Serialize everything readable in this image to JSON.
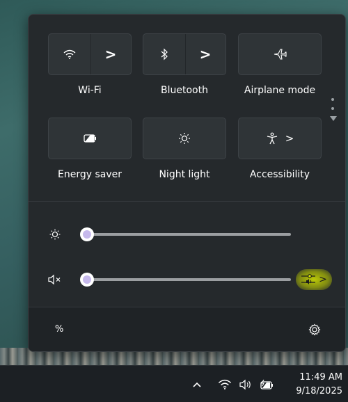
{
  "quick_settings": {
    "tiles": [
      {
        "label": "Wi-Fi",
        "icon": "wifi-icon",
        "has_chevron": true
      },
      {
        "label": "Bluetooth",
        "icon": "bluetooth-icon",
        "has_chevron": true
      },
      {
        "label": "Airplane mode",
        "icon": "airplane-icon",
        "has_chevron": false
      },
      {
        "label": "Energy saver",
        "icon": "energy-saver-icon",
        "has_chevron": false
      },
      {
        "label": "Night light",
        "icon": "night-light-icon",
        "has_chevron": false
      },
      {
        "label": "Accessibility",
        "icon": "accessibility-icon",
        "has_chevron": true
      }
    ],
    "chevron_glyph": ">",
    "pages": {
      "total": 2,
      "current": 1
    },
    "brightness": {
      "icon": "brightness-icon",
      "level": 0
    },
    "volume": {
      "icon": "volume-muted-icon",
      "level": 0,
      "mixer_icon": "sound-mixer-icon",
      "mixer_highlight": "#d6e600"
    },
    "footer": {
      "battery_text": "%",
      "settings_icon": "gear-icon"
    }
  },
  "taskbar": {
    "overflow_glyph": "^",
    "tray_icons": [
      "wifi-icon",
      "speaker-icon",
      "battery-charging-icon"
    ],
    "time": "11:49 AM",
    "date": "9/18/2025"
  },
  "colors": {
    "accent": "#c6b9ec",
    "panel_bg": "#25292c",
    "tile_bg": "#2f3437"
  }
}
